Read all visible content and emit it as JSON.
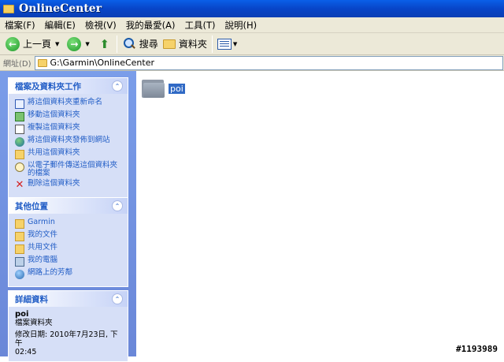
{
  "window": {
    "title": "OnlineCenter"
  },
  "menu": [
    "檔案(F)",
    "編輯(E)",
    "檢視(V)",
    "我的最愛(A)",
    "工具(T)",
    "說明(H)"
  ],
  "toolbar": {
    "back_label": "上一頁",
    "search_label": "搜尋",
    "folders_label": "資料夾"
  },
  "address": {
    "label": "網址(D)",
    "path": "G:\\Garmin\\OnlineCenter"
  },
  "tasks_panel": {
    "title": "檔案及資料夾工作",
    "items": [
      {
        "label": "將這個資料夾重新命名",
        "icon": "rename-icon"
      },
      {
        "label": "移動這個資料夾",
        "icon": "move-icon"
      },
      {
        "label": "複製這個資料夾",
        "icon": "copy-icon"
      },
      {
        "label": "將這個資料夾發佈到網站",
        "icon": "publish-web-icon"
      },
      {
        "label": "共用這個資料夾",
        "icon": "share-icon"
      },
      {
        "label": "以電子郵件傳送這個資料夾的檔案",
        "icon": "email-icon"
      },
      {
        "label": "刪除這個資料夾",
        "icon": "delete-icon"
      }
    ]
  },
  "places_panel": {
    "title": "其他位置",
    "items": [
      {
        "label": "Garmin",
        "icon": "folder-icon"
      },
      {
        "label": "我的文件",
        "icon": "documents-icon"
      },
      {
        "label": "共用文件",
        "icon": "shared-docs-icon"
      },
      {
        "label": "我的電腦",
        "icon": "computer-icon"
      },
      {
        "label": "網路上的芳鄰",
        "icon": "network-icon"
      }
    ]
  },
  "details_panel": {
    "title": "詳細資料",
    "name": "poi",
    "type": "檔案資料夾",
    "modified_line1": "修改日期: 2010年7月23日, 下午",
    "modified_line2": "02:45"
  },
  "content": {
    "items": [
      {
        "label": "poi",
        "icon": "folder-icon"
      }
    ]
  },
  "watermark": "#1193989"
}
